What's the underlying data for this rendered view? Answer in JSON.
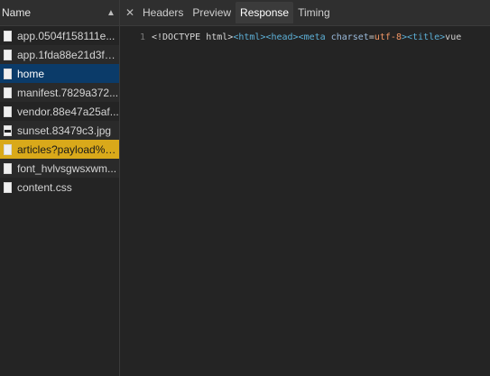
{
  "left_panel": {
    "header_title": "Name",
    "sort_indicator": "▲",
    "items": [
      {
        "label": "app.0504f158111e...",
        "icon": "document-icon"
      },
      {
        "label": "app.1fda88e21d3f5...",
        "icon": "document-icon"
      },
      {
        "label": "home",
        "icon": "document-icon",
        "state": "selected"
      },
      {
        "label": "manifest.7829a372...",
        "icon": "document-icon"
      },
      {
        "label": "vendor.88e47a25af...",
        "icon": "document-icon"
      },
      {
        "label": "sunset.83479c3.jpg",
        "icon": "image-icon"
      },
      {
        "label": "articles?payload%5...",
        "icon": "document-icon",
        "state": "highlighted"
      },
      {
        "label": "font_hvlvsgwsxwm...",
        "icon": "document-icon"
      },
      {
        "label": "content.css",
        "icon": "document-icon"
      }
    ]
  },
  "right_panel": {
    "close_glyph": "✕",
    "tabs": [
      {
        "label": "Headers"
      },
      {
        "label": "Preview"
      },
      {
        "label": "Response",
        "active": true
      },
      {
        "label": "Timing"
      }
    ],
    "response": {
      "line_number": "1",
      "tokens": {
        "doctype": "<!DOCTYPE html>",
        "html_open": "<html>",
        "head_open": "<head>",
        "meta_open": "<meta ",
        "meta_attr": "charset",
        "equals": "=",
        "meta_val": "utf-8",
        "meta_close": ">",
        "title_open": "<title>",
        "title_text": "vue"
      }
    }
  },
  "colors": {
    "background": "#242424",
    "header_background": "#2f2f2f",
    "selected_row": "#0b3b69",
    "highlighted_row": "#d9a91a",
    "active_tab": "#3b3b3b",
    "tag_color": "#5db0d7",
    "value_color": "#f29766"
  }
}
